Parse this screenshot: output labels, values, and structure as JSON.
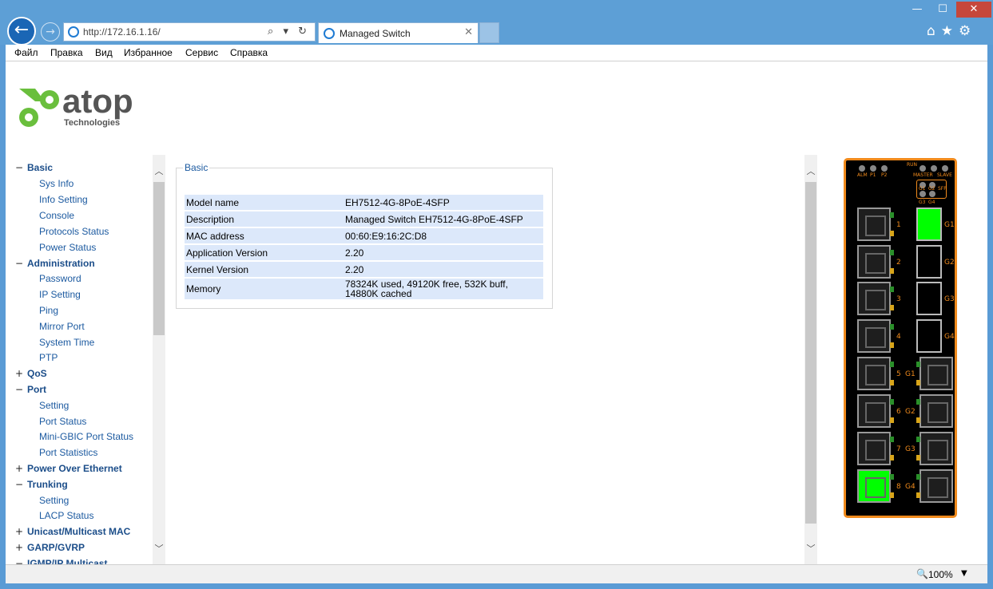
{
  "browser": {
    "address_url": "http://172.16.1.16/",
    "tab_title": "Managed Switch",
    "window_controls": {
      "minimize": "—",
      "maximize": "☐",
      "close": "✕"
    },
    "nav": {
      "back": "←",
      "forward": "→"
    },
    "address_tools": "⌕ ▾ ↻",
    "tab_close": "✕",
    "toolbar_icons": [
      "home-icon",
      "star-icon",
      "gear-icon"
    ],
    "menu": [
      "Файл",
      "Правка",
      "Вид",
      "Избранное",
      "Сервис",
      "Справка"
    ]
  },
  "logo": {
    "name": "atop",
    "tagline": "Technologies"
  },
  "sidebar": {
    "items": [
      {
        "toggle": "−",
        "label": "Basic",
        "type": "cat"
      },
      {
        "label": "Sys Info",
        "type": "sub"
      },
      {
        "label": "Info Setting",
        "type": "sub"
      },
      {
        "label": "Console",
        "type": "sub"
      },
      {
        "label": "Protocols Status",
        "type": "sub"
      },
      {
        "label": "Power Status",
        "type": "sub"
      },
      {
        "toggle": "−",
        "label": "Administration",
        "type": "cat"
      },
      {
        "label": "Password",
        "type": "sub"
      },
      {
        "label": "IP Setting",
        "type": "sub"
      },
      {
        "label": "Ping",
        "type": "sub"
      },
      {
        "label": "Mirror Port",
        "type": "sub"
      },
      {
        "label": "System Time",
        "type": "sub"
      },
      {
        "label": "PTP",
        "type": "sub"
      },
      {
        "toggle": "+",
        "label": "QoS",
        "type": "cat"
      },
      {
        "toggle": "−",
        "label": "Port",
        "type": "cat"
      },
      {
        "label": "Setting",
        "type": "sub"
      },
      {
        "label": "Port Status",
        "type": "sub"
      },
      {
        "label": "Mini-GBIC Port Status",
        "type": "sub"
      },
      {
        "label": "Port Statistics",
        "type": "sub"
      },
      {
        "toggle": "+",
        "label": "Power Over Ethernet",
        "type": "cat"
      },
      {
        "toggle": "−",
        "label": "Trunking",
        "type": "cat"
      },
      {
        "label": "Setting",
        "type": "sub"
      },
      {
        "label": "LACP Status",
        "type": "sub"
      },
      {
        "toggle": "+",
        "label": "Unicast/Multicast MAC",
        "type": "cat"
      },
      {
        "toggle": "+",
        "label": "GARP/GVRP",
        "type": "cat"
      },
      {
        "toggle": "−",
        "label": "IGMP/IP Multicast",
        "type": "cat"
      }
    ],
    "scroll_up": "︿",
    "scroll_down": "﹀"
  },
  "main": {
    "section_title": "Basic",
    "rows": [
      {
        "label": "Model name",
        "value": "EH7512-4G-8PoE-4SFP"
      },
      {
        "label": "Description",
        "value": "Managed Switch EH7512-4G-8PoE-4SFP"
      },
      {
        "label": "MAC address",
        "value": "00:60:E9:16:2C:D8"
      },
      {
        "label": "Application Version",
        "value": "2.20"
      },
      {
        "label": "Kernel Version",
        "value": "2.20"
      },
      {
        "label": "Memory",
        "value": "78324K used, 49120K free, 532K buff, 14880K cached"
      }
    ],
    "scroll_up": "︿",
    "scroll_down": "﹀"
  },
  "device": {
    "led_labels": [
      "ALM",
      "P1",
      "P2"
    ],
    "led_labels_right": [
      "RUN",
      "MASTER",
      "SLAVE"
    ],
    "led_labels_sfp": [
      "G1",
      "G2",
      "G3",
      "G4",
      "SFP"
    ],
    "sfp_labels": [
      "G1",
      "G2",
      "G3",
      "G4"
    ],
    "rj_right_labels": [
      "G1",
      "G2",
      "G3",
      "G4"
    ],
    "left_port_nums": [
      "1",
      "2",
      "3",
      "4",
      "5",
      "6",
      "7",
      "8"
    ],
    "accent": "#f08a1c",
    "link_active": "#00ff00"
  },
  "statusbar": {
    "zoom_icon": "🔍",
    "zoom": "100%",
    "zoom_dropdown": "▼"
  }
}
